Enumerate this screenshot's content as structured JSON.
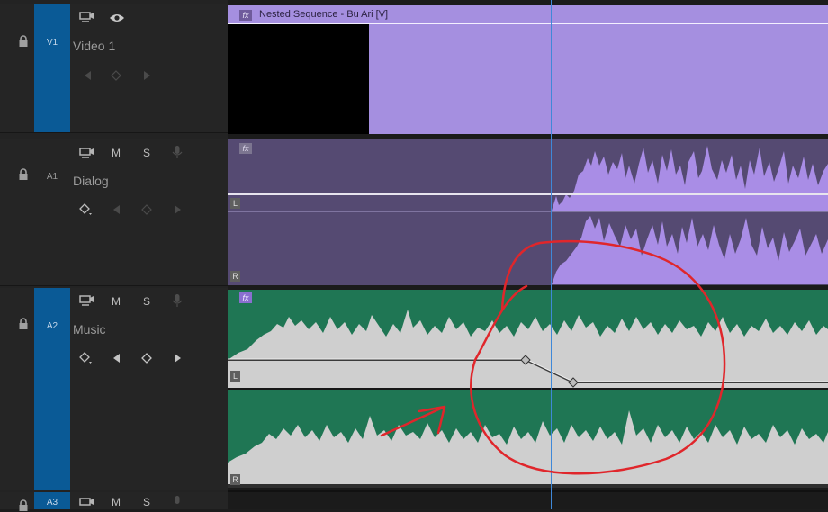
{
  "tracks": {
    "v1": {
      "target": "V1",
      "name": "Video 1"
    },
    "a1": {
      "target": "A1",
      "name": "Dialog",
      "mute": "M",
      "solo": "S",
      "channels": [
        "L",
        "R"
      ]
    },
    "a2": {
      "target": "A2",
      "name": "Music",
      "mute": "M",
      "solo": "S",
      "channels": [
        "L",
        "R"
      ]
    },
    "a3": {
      "target": "A3",
      "mute": "M",
      "solo": "S"
    }
  },
  "clips": {
    "video": {
      "fx": "fx",
      "title": "Nested Sequence - Bu Ari [V]"
    },
    "dialog": {
      "fx": "fx"
    },
    "music": {
      "fx": "fx"
    }
  },
  "colors": {
    "video_clip": "#a58fe0",
    "dialog_clip": "#554a72",
    "dialog_waveform": "#a98de6",
    "music_clip": "#1f7654",
    "music_waveform": "#cfcfcf",
    "playhead": "#3f88d8",
    "annotation": "#e0262b"
  },
  "icons": [
    "lock-icon",
    "sync-icon",
    "eye-icon",
    "keyframe-prev-icon",
    "keyframe-add-icon",
    "keyframe-next-icon",
    "microphone-icon",
    "pan-dropdown-icon"
  ]
}
